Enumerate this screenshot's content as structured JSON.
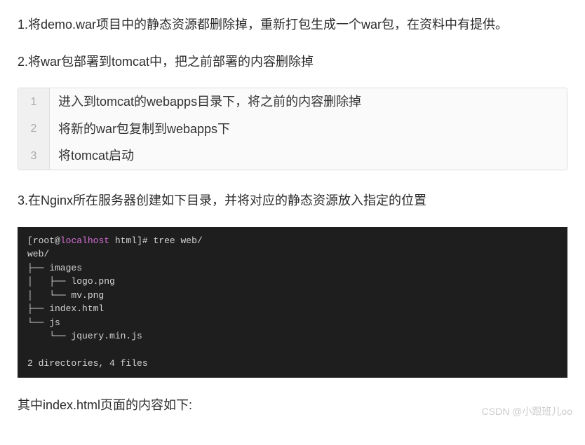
{
  "para1": "1.将demo.war项目中的静态资源都删除掉，重新打包生成一个war包，在资料中有提供。",
  "para2": "2.将war包部署到tomcat中，把之前部署的内容删除掉",
  "codeBlock": {
    "lines": [
      {
        "num": "1",
        "text": "进入到tomcat的webapps目录下，将之前的内容删除掉"
      },
      {
        "num": "2",
        "text": "将新的war包复制到webapps下"
      },
      {
        "num": "3",
        "text": "将tomcat启动"
      }
    ]
  },
  "para3": "3.在Nginx所在服务器创建如下目录，并将对应的静态资源放入指定的位置",
  "terminal": {
    "promptOpen": "[",
    "root": "root",
    "at": "@",
    "host": "localhost",
    "space": " ",
    "path": "html",
    "promptClose": "]# ",
    "command": "tree web/",
    "output": "web/\n├── images\n│   ├── logo.png\n│   └── mv.png\n├── index.html\n└── js\n    └── jquery.min.js\n\n2 directories, 4 files"
  },
  "para4": "其中index.html页面的内容如下:",
  "watermark": "CSDN @小跟班儿oo"
}
